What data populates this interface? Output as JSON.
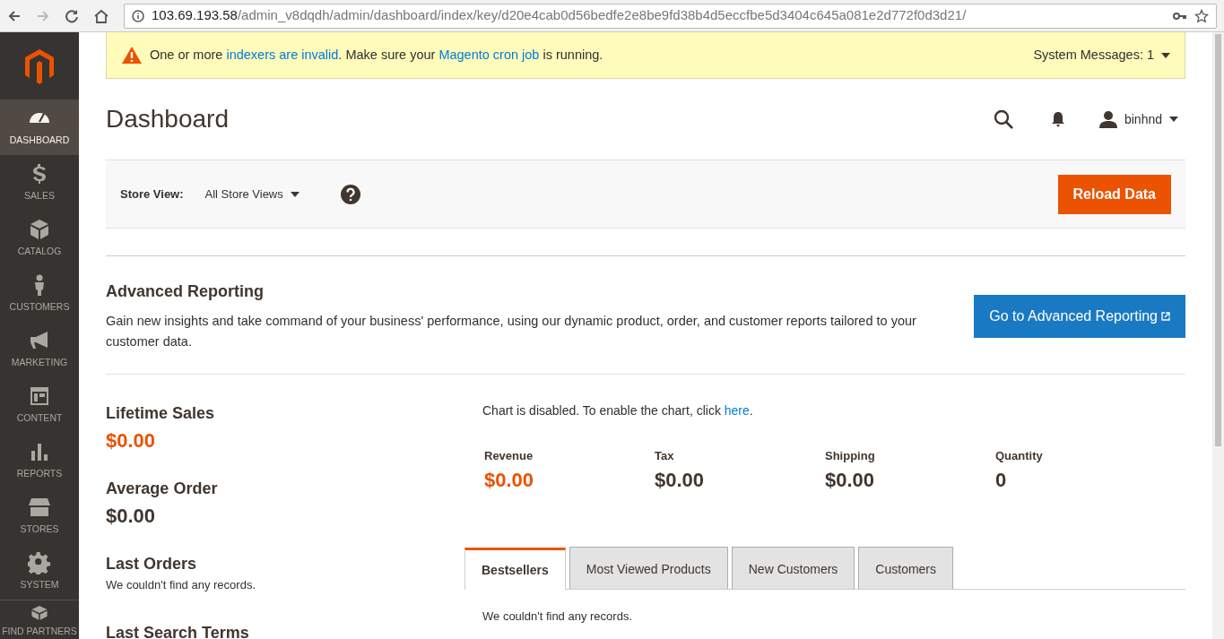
{
  "browser": {
    "url_host": "103.69.193.58",
    "url_path": "/admin_v8dqdh/admin/dashboard/index/key/d20e4cab0d56bedfe2e8be9fd38b4d5eccfbe5d3404c645a081e2d772f0d3d21/"
  },
  "sidebar": {
    "items": [
      {
        "label": "DASHBOARD",
        "selected": true
      },
      {
        "label": "SALES",
        "selected": false
      },
      {
        "label": "CATALOG",
        "selected": false
      },
      {
        "label": "CUSTOMERS",
        "selected": false
      },
      {
        "label": "MARKETING",
        "selected": false
      },
      {
        "label": "CONTENT",
        "selected": false
      },
      {
        "label": "REPORTS",
        "selected": false
      },
      {
        "label": "STORES",
        "selected": false
      },
      {
        "label": "SYSTEM",
        "selected": false
      },
      {
        "label": "FIND PARTNERS",
        "selected": false
      }
    ]
  },
  "system_message": {
    "parts": [
      {
        "text": "One or more ",
        "link": false
      },
      {
        "text": "indexers are invalid",
        "link": true
      },
      {
        "text": ". Make sure your ",
        "link": false
      },
      {
        "text": "Magento cron job",
        "link": true
      },
      {
        "text": " is running.",
        "link": false
      }
    ],
    "counter": "System Messages: 1"
  },
  "header": {
    "title": "Dashboard",
    "user": "binhnd"
  },
  "store_view": {
    "label": "Store View:",
    "value": "All Store Views",
    "button": "Reload Data"
  },
  "advanced_reporting": {
    "title": "Advanced Reporting",
    "text": "Gain new insights and take command of your business' performance, using our dynamic product, order, and customer reports tailored to your customer data.",
    "button": "Go to Advanced Reporting"
  },
  "stats": [
    {
      "label": "Lifetime Sales",
      "value": "$0.00",
      "highlight": true
    },
    {
      "label": "Average Order",
      "value": "$0.00",
      "highlight": false
    }
  ],
  "chart_notice": [
    {
      "text": "Chart is disabled. To enable the chart, click ",
      "link": false
    },
    {
      "text": "here",
      "link": true
    },
    {
      "text": ".",
      "link": false
    }
  ],
  "totals": [
    {
      "label": "Revenue",
      "value": "$0.00",
      "highlight": true
    },
    {
      "label": "Tax",
      "value": "$0.00",
      "highlight": false
    },
    {
      "label": "Shipping",
      "value": "$0.00",
      "highlight": false
    },
    {
      "label": "Quantity",
      "value": "0",
      "highlight": false
    }
  ],
  "last_orders": {
    "title": "Last Orders",
    "empty": "We couldn't find any records."
  },
  "last_search_terms": {
    "title": "Last Search Terms"
  },
  "tabs": [
    {
      "label": "Bestsellers",
      "selected": true
    },
    {
      "label": "Most Viewed Products",
      "selected": false
    },
    {
      "label": "New Customers",
      "selected": false
    },
    {
      "label": "Customers",
      "selected": false
    }
  ],
  "tab_content": "We couldn't find any records."
}
